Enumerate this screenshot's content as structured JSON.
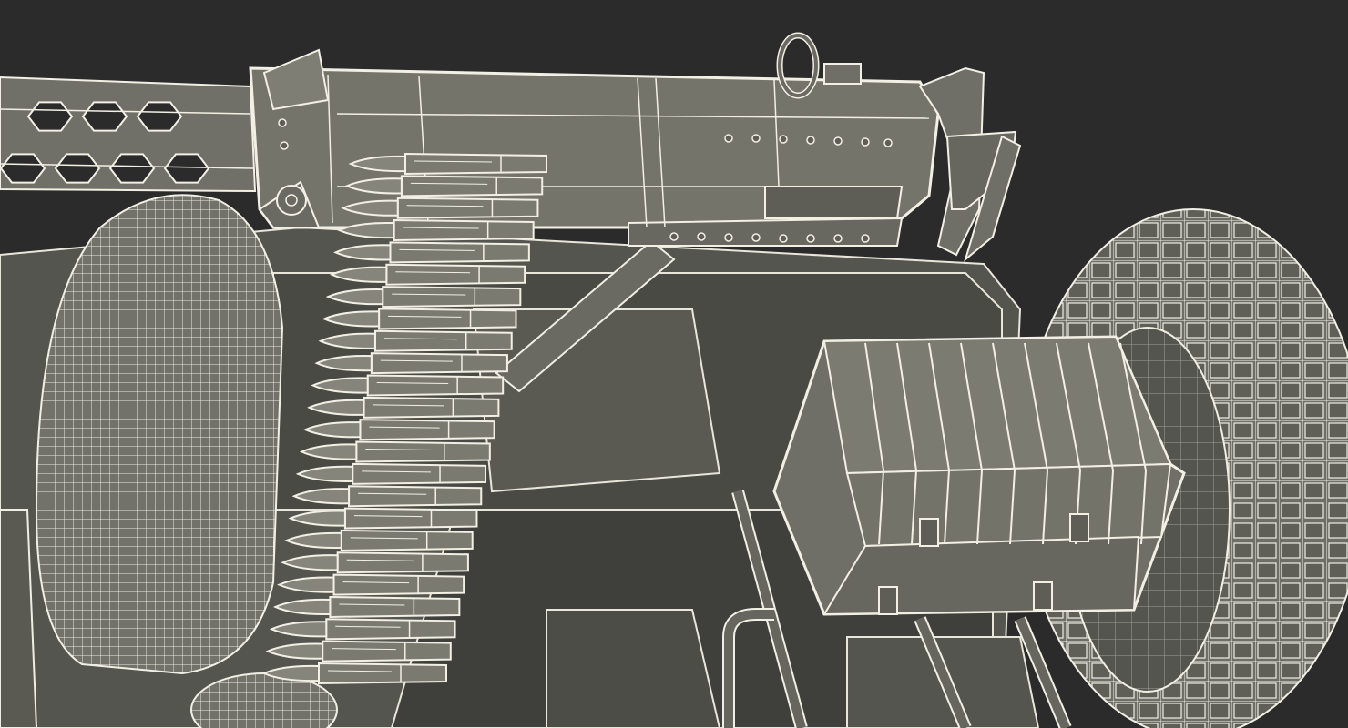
{
  "scene": {
    "description_colors": {
      "background": "#2b2b2b",
      "model_fill": "#6b6b62",
      "model_fill_light": "#7e7e74",
      "model_fill_dark": "#4e4e48",
      "wireframe": "#f2f0e4"
    },
    "subject": "wireframe-3d-render",
    "parts": [
      {
        "name": "gun-barrel-shroud-icon"
      },
      {
        "name": "gun-receiver-icon"
      },
      {
        "name": "ammo-belt-icon"
      },
      {
        "name": "rear-sight-ring-icon"
      },
      {
        "name": "ammo-crate-icon"
      },
      {
        "name": "left-wheel-icon"
      },
      {
        "name": "right-wheel-icon"
      },
      {
        "name": "vehicle-body-icon"
      }
    ]
  }
}
